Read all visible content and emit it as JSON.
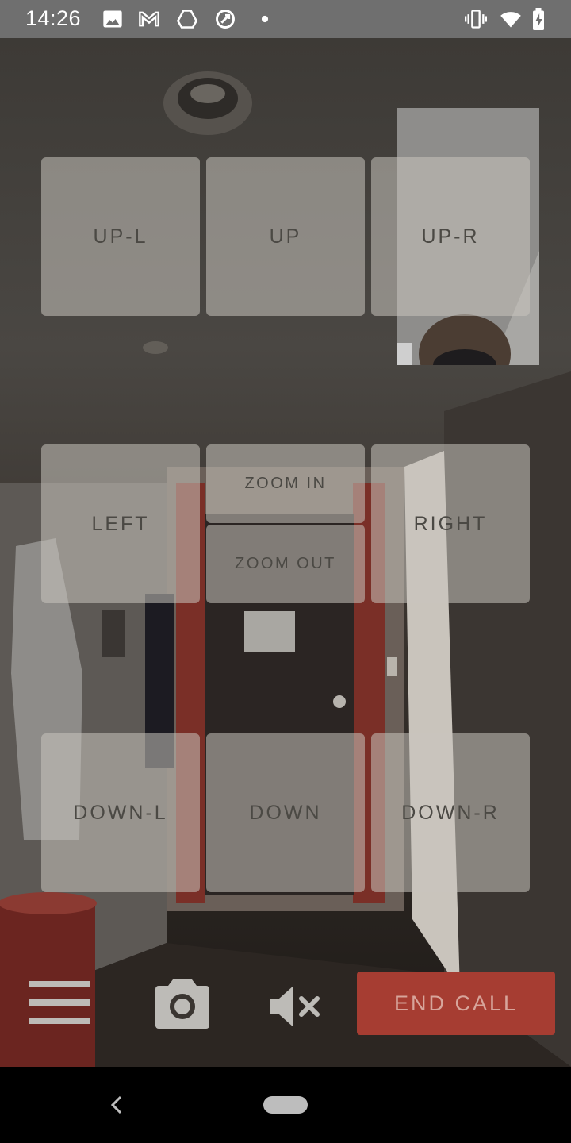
{
  "status_bar": {
    "time": "14:26",
    "left_icons": [
      "image-icon",
      "gmail-icon",
      "drive-icon",
      "sync-icon",
      "dot-icon"
    ],
    "right_icons": [
      "vibrate-icon",
      "wifi-icon",
      "battery-charging-icon"
    ]
  },
  "controls": {
    "up_left": "UP-L",
    "up": "UP",
    "up_right": "UP-R",
    "left": "LEFT",
    "zoom_in": "ZOOM IN",
    "zoom_out": "ZOOM OUT",
    "right": "RIGHT",
    "down_left": "DOWN-L",
    "down": "DOWN",
    "down_right": "DOWN-R"
  },
  "bottom_bar": {
    "menu_icon": "hamburger-menu-icon",
    "camera_icon": "camera-icon",
    "mute_icon": "volume-muted-icon",
    "end_call": "END CALL"
  },
  "colors": {
    "end_call_bg": "#a63d32",
    "end_call_text": "#d7a59b",
    "button_text": "#4b4944"
  }
}
